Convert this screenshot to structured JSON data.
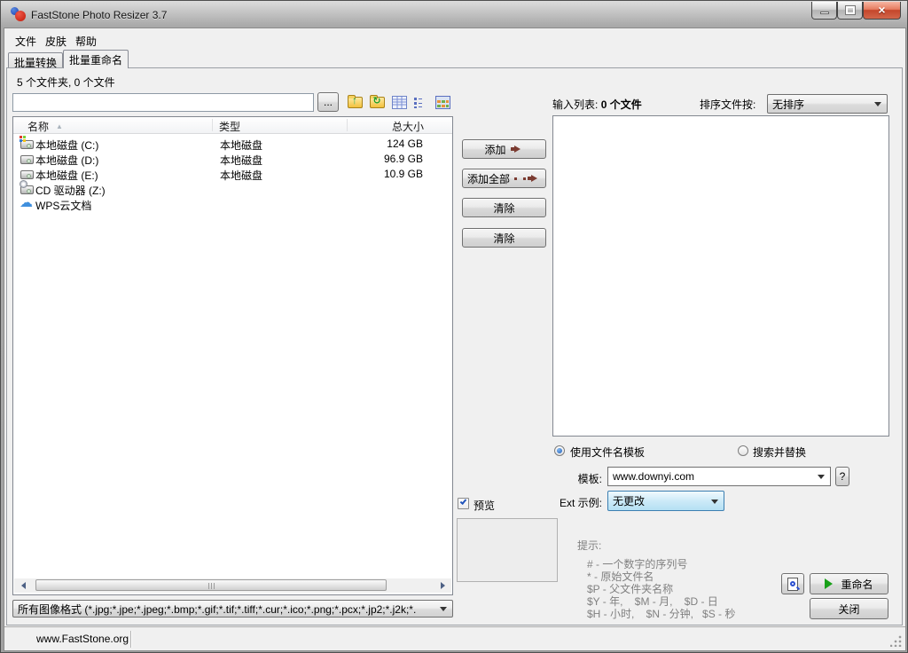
{
  "window": {
    "title": "FastStone Photo Resizer 3.7",
    "status_text": "www.FastStone.org"
  },
  "menu_bar": {
    "items": [
      {
        "label": "文件"
      },
      {
        "label": "皮肤"
      },
      {
        "label": "帮助"
      }
    ]
  },
  "tabs": [
    {
      "label": "批量转换",
      "active": false
    },
    {
      "label": "批量重命名",
      "active": true
    }
  ],
  "folder_browser": {
    "summary": "5 个文件夹, 0 个文件",
    "path_value": "",
    "browse_button": "...",
    "columns": {
      "name": "名称",
      "type": "类型",
      "size": "总大小"
    },
    "rows": [
      {
        "icon": "system-drive-icon",
        "name": "本地磁盘 (C:)",
        "type": "本地磁盘",
        "size": "124 GB"
      },
      {
        "icon": "drive-icon",
        "name": "本地磁盘 (D:)",
        "type": "本地磁盘",
        "size": "96.9 GB"
      },
      {
        "icon": "drive-icon",
        "name": "本地磁盘 (E:)",
        "type": "本地磁盘",
        "size": "10.9 GB"
      },
      {
        "icon": "cd-drive-icon",
        "name": "CD 驱动器 (Z:)",
        "type": "",
        "size": ""
      },
      {
        "icon": "cloud-icon",
        "name": "WPS云文档",
        "type": "",
        "size": ""
      }
    ],
    "format_filter": "所有图像格式 (*.jpg;*.jpe;*.jpeg;*.bmp;*.gif;*.tif;*.tiff;*.cur;*.ico;*.png;*.pcx;*.jp2;*.j2k;*."
  },
  "transfer_buttons": {
    "add": "添加",
    "add_all": "添加全部",
    "clear_1": "清除",
    "clear_2": "清除"
  },
  "preview": {
    "label": "预览",
    "checked": true
  },
  "input_list": {
    "label": "输入列表:",
    "count": "0 个文件",
    "sort_label": "排序文件按:",
    "sort_value": "无排序"
  },
  "rename_options": {
    "use_template_label": "使用文件名模板",
    "search_replace_label": "搜索并替换",
    "template_label": "模板:",
    "template_value": "www.downyi.com",
    "template_help": "?",
    "ext_label": "Ext 示例:",
    "ext_value": "无更改",
    "hint_title": "提示:",
    "hints": [
      "# - 一个数字的序列号",
      "* - 原始文件名",
      "$P - 父文件夹名称",
      "$Y - 年,    $M - 月,    $D - 日",
      "$H - 小时,    $N - 分钟,   $S - 秒"
    ],
    "rename_button": "重命名",
    "close_button": "关闭"
  },
  "icons": {
    "toolbar": [
      "folder-up-icon",
      "refresh-icon",
      "details-view-icon",
      "list-view-icon",
      "thumbnails-view-icon"
    ],
    "colors": {
      "focus_border": "#3c7fb1",
      "play_green": "#18a018",
      "add_arrow": "#7b3b31",
      "close_red": "#c4462b"
    }
  }
}
